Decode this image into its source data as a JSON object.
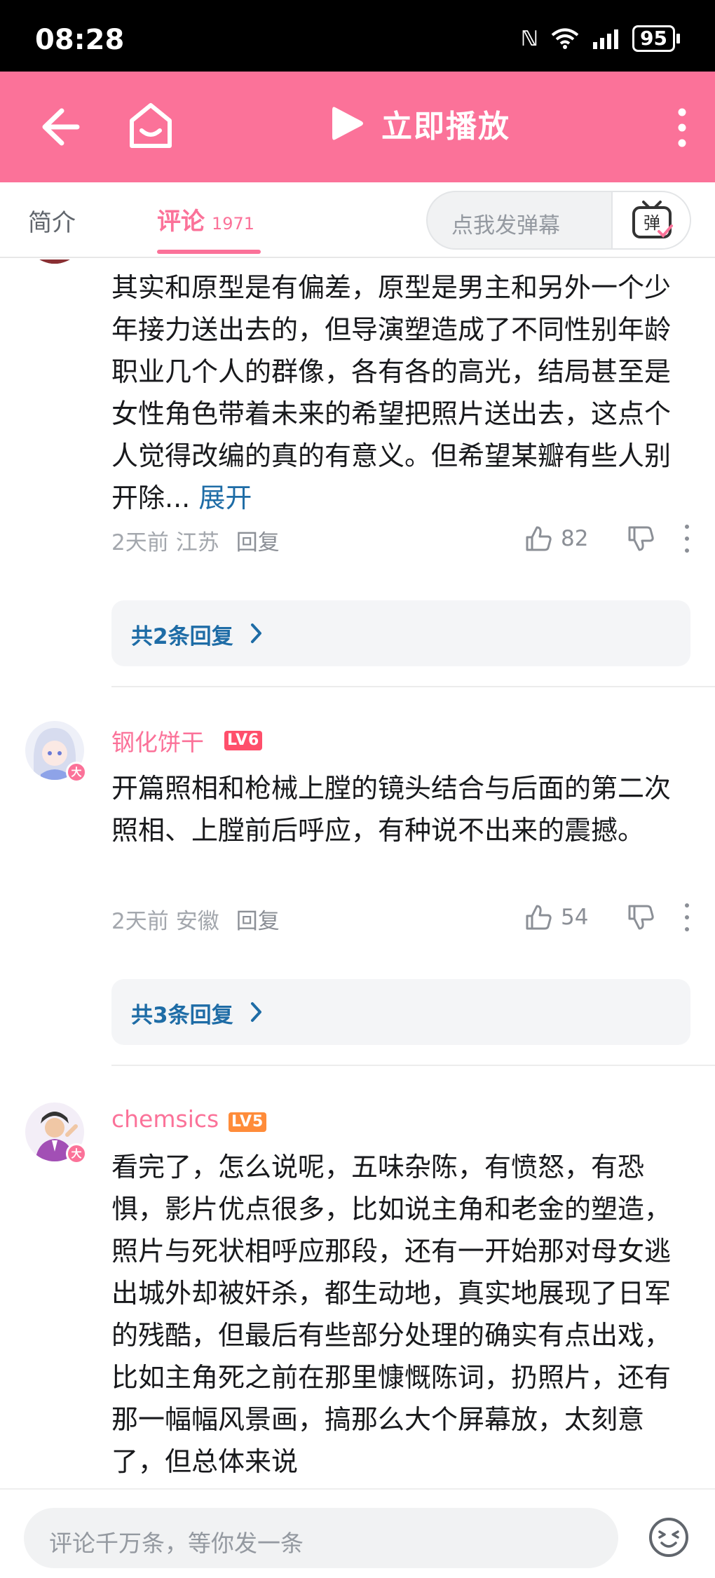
{
  "status_bar": {
    "time": "08:28",
    "battery": "95",
    "icons": [
      "nfc-icon",
      "wifi-icon",
      "signal-icon",
      "battery-icon"
    ]
  },
  "header": {
    "play_label": "立即播放",
    "background_color": "#fb7299",
    "icons": [
      "back-arrow-icon",
      "home-icon",
      "play-icon",
      "more-vertical-icon"
    ]
  },
  "tabs": {
    "intro": "简介",
    "comments": "评论",
    "comments_count": "1971",
    "danmaku_placeholder": "点我发弹幕",
    "danmaku_button": "弹"
  },
  "comments": [
    {
      "text": "其实和原型是有偏差，原型是男主和另外一个少年接力送出去的，但导演塑造成了不同性别年龄职业几个人的群像，各有各的高光，结局甚至是女性角色带着未来的希望把照片送出去，这点个人觉得改编的真的有意义。但希望某瓣有些人别开除...",
      "expand": "展开",
      "time": "2天前",
      "location": "江苏",
      "reply": "回复",
      "likes": "82",
      "replies_label": "共2条回复"
    },
    {
      "username": "钢化饼干",
      "level": "LV6",
      "badge": "大",
      "text": "开篇照相和枪械上膛的镜头结合与后面的第二次照相、上膛前后呼应，有种说不出来的震撼。",
      "time": "2天前",
      "location": "安徽",
      "reply": "回复",
      "likes": "54",
      "replies_label": "共3条回复"
    },
    {
      "username": "chemsics",
      "level": "LV5",
      "badge": "大",
      "text": "看完了，怎么说呢，五味杂陈，有愤怒，有恐惧，影片优点很多，比如说主角和老金的塑造，照片与死状相呼应那段，还有一开始那对母女逃出城外却被奸杀，都生动地，真实地展现了日军的残酷，但最后有些部分处理的确实有点出戏，比如主角死之前在那里慷慨陈词，扔照片，还有那一幅幅风景画，搞那么大个屏幕放，太刻意了，但总体来说"
    }
  ],
  "bottom_bar": {
    "input_placeholder": "评论千万条，等你发一条",
    "icons": [
      "emoji-icon"
    ]
  }
}
